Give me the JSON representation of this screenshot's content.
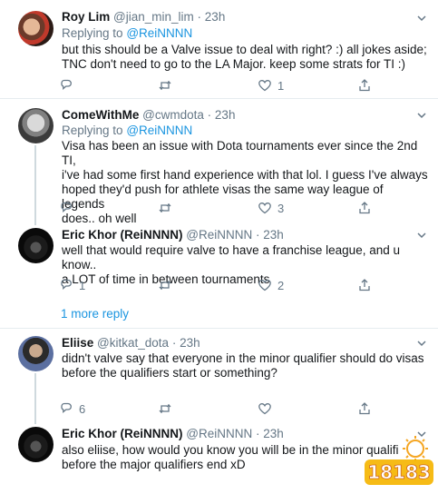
{
  "tweets": [
    {
      "name": "Roy Lim",
      "handle": "@jian_min_lim",
      "time": "23h",
      "replying_label": "Replying to",
      "replying_to": "@ReiNNNN",
      "text_lines": [
        "but this should be a Valve issue to deal with right? :) all jokes aside;",
        "TNC don't need to go to the LA Major. keep some strats for TI :)"
      ],
      "replies": "",
      "retweets": "",
      "likes": "1"
    },
    {
      "name": "ComeWithMe",
      "handle": "@cwmdota",
      "time": "23h",
      "replying_label": "Replying to",
      "replying_to": "@ReiNNNN",
      "text_lines": [
        "Visa has been an issue with Dota tournaments ever since the 2nd TI,",
        "i've had some first hand experience with that lol. I guess I've always",
        "hoped they'd push for athlete visas the same way league of legends",
        "does.. oh well"
      ],
      "replies": "",
      "retweets": "",
      "likes": "3"
    },
    {
      "name": "Eric Khor (ReiNNNN)",
      "handle": "@ReiNNNN",
      "time": "23h",
      "text_lines": [
        "well that would require valve to have a franchise league, and u know..",
        "a LOT of time in between tournaments"
      ],
      "replies": "1",
      "retweets": "",
      "likes": "2"
    },
    {
      "name": "Eliise",
      "handle": "@kitkat_dota",
      "time": "23h",
      "text_lines": [
        "didn't valve say that everyone in the minor qualifier should do visas",
        "before the qualifiers start or something?"
      ],
      "replies": "6",
      "retweets": "",
      "likes": ""
    },
    {
      "name": "Eric Khor (ReiNNNN)",
      "handle": "@ReiNNNN",
      "time": "23h",
      "text_lines": [
        "also eliise, how would you know you will be in the minor qualifi",
        "before the major qualifiers end xD"
      ]
    }
  ],
  "more_replies": "1 more reply",
  "separator": "·",
  "icons": [
    "chevron-down-icon",
    "reply-icon",
    "retweet-icon",
    "like-icon",
    "share-icon"
  ],
  "colors": {
    "link": "#1b95e0",
    "muted": "#657786",
    "text": "#14171a",
    "divider": "#e6ecf0"
  },
  "watermark": "18183"
}
